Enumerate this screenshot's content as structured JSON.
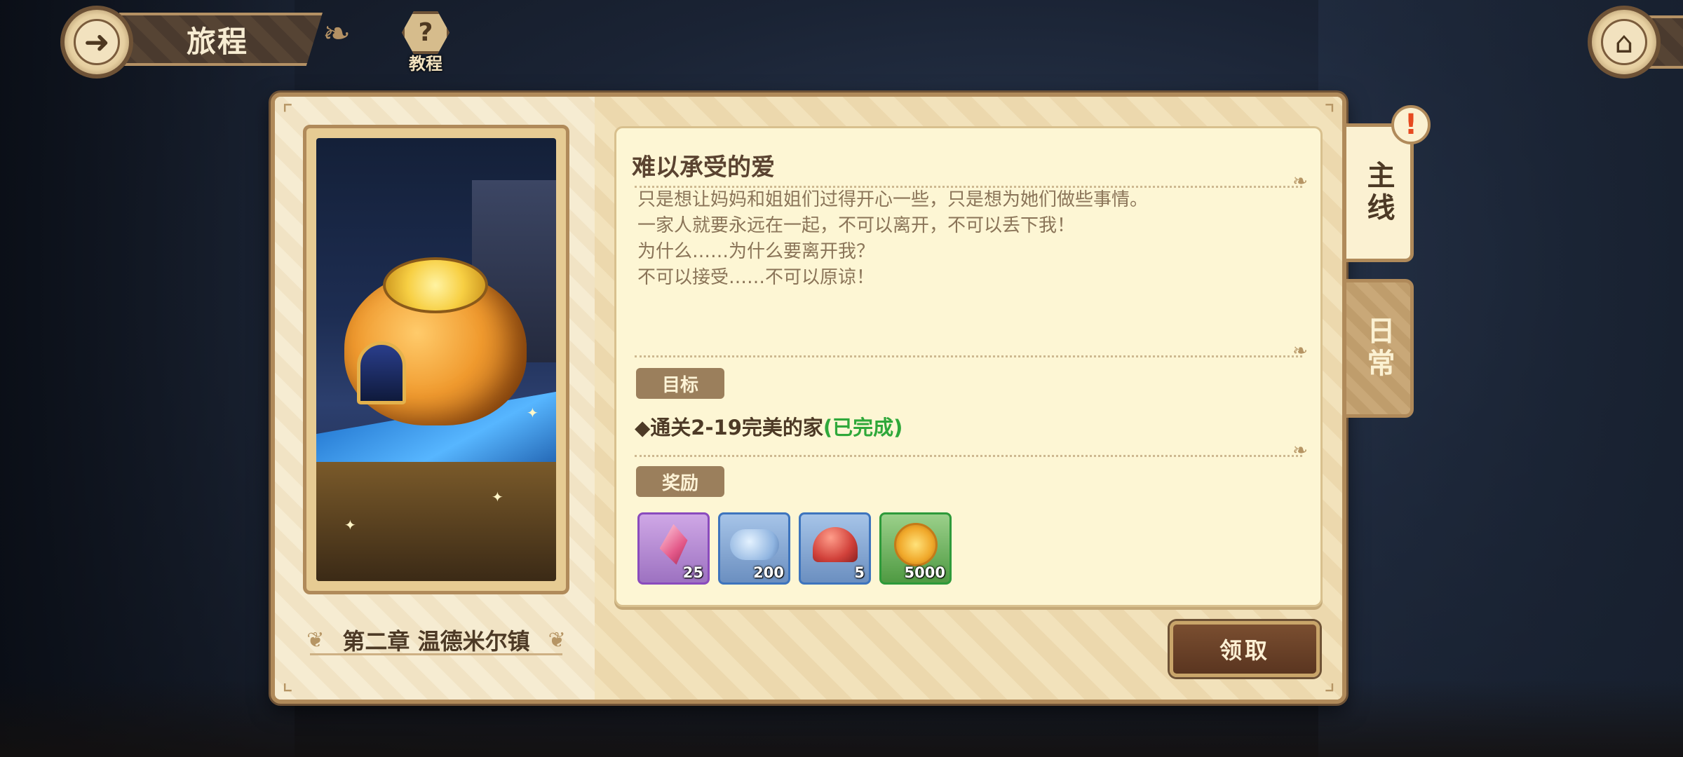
{
  "header": {
    "title": "旅程",
    "tutorial_label": "教程",
    "tutorial_glyph": "?",
    "back_icon": "back-arrow-icon",
    "home_icon": "home-icon"
  },
  "chapter": {
    "label": "第二章 温德米尔镇"
  },
  "quest": {
    "title": "难以承受的爱",
    "description": [
      "只是想让妈妈和姐姐们过得开心一些，只是想为她们做些事情。",
      "一家人就要永远在一起，不可以离开，不可以丢下我！",
      "为什么……为什么要离开我？",
      "不可以接受……不可以原谅！"
    ],
    "objective_tag": "目标",
    "objective_text": "◆通关2-19完美的家",
    "objective_status": "(已完成)",
    "reward_tag": "奖励",
    "rewards": [
      {
        "icon": "crystal-gem-icon",
        "count": "25",
        "rarity_color": "#8a4bbd"
      },
      {
        "icon": "star-cloud-icon",
        "count": "200",
        "rarity_color": "#3d74bd"
      },
      {
        "icon": "mushroom-icon",
        "count": "5",
        "rarity_color": "#3d74bd"
      },
      {
        "icon": "gold-coin-icon",
        "count": "5000",
        "rarity_color": "#2e9a3a"
      }
    ],
    "claim_label": "领取"
  },
  "tabs": {
    "main": "主线",
    "daily": "日常",
    "alert": "!"
  },
  "colors": {
    "completed": "#2fa83a",
    "panel": "#f1e3c0",
    "card": "#fdf6d4",
    "accent_brown": "#5a3520"
  }
}
